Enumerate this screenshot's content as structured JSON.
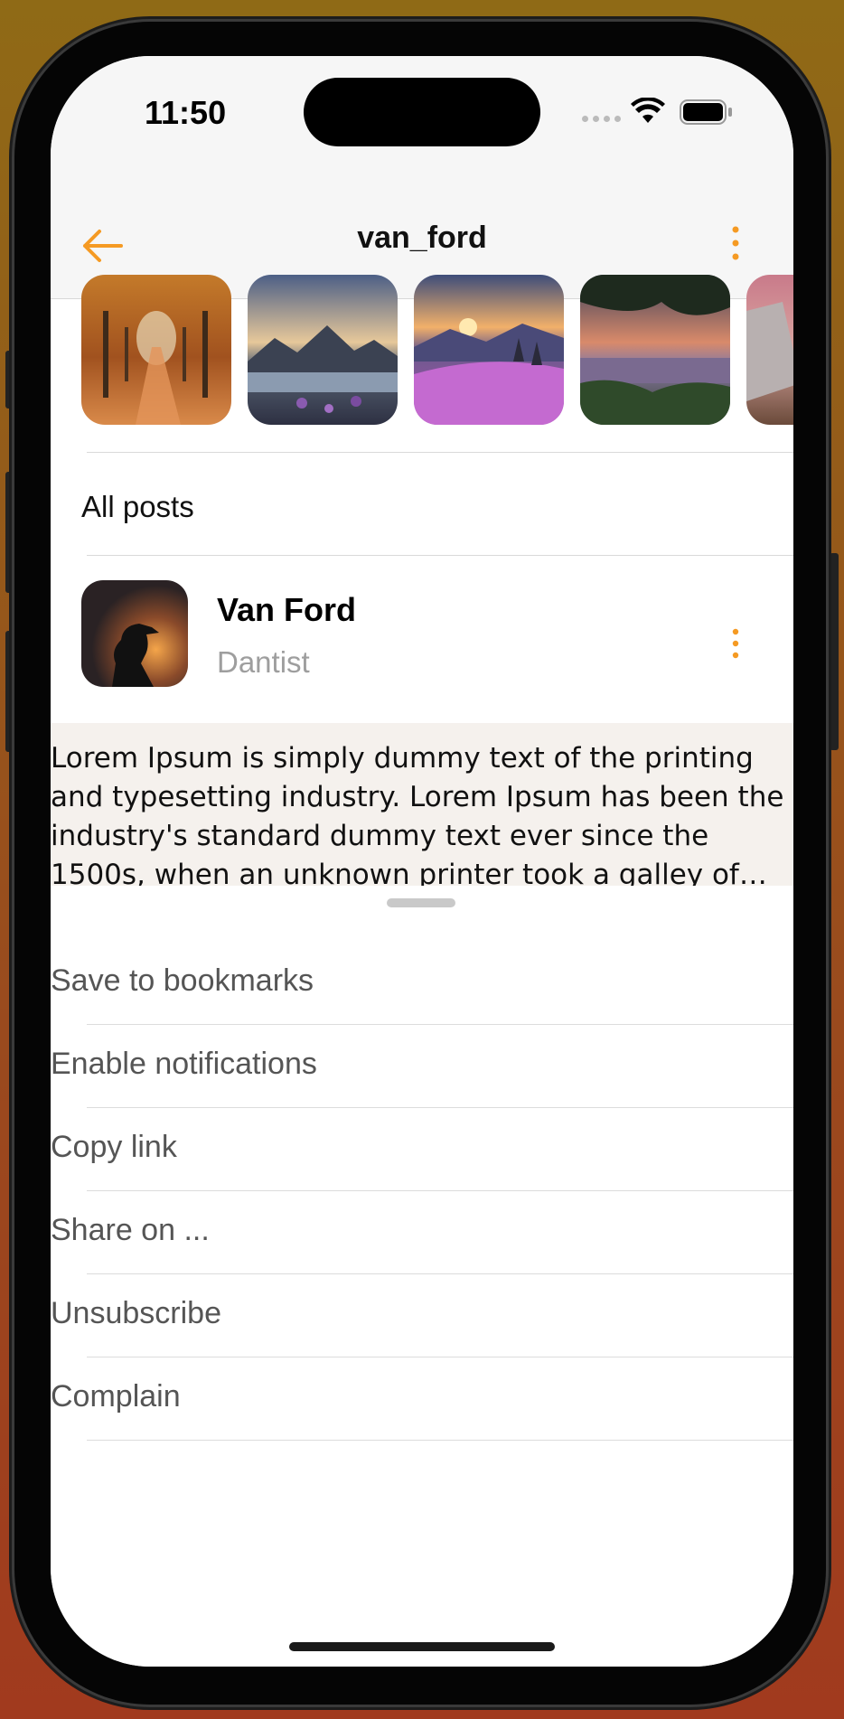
{
  "status_bar": {
    "time": "11:50"
  },
  "nav": {
    "title": "van_ford"
  },
  "stories": [
    {
      "name": "autumn-alley"
    },
    {
      "name": "mountain-lake-sunrise"
    },
    {
      "name": "flower-meadow-sunset"
    },
    {
      "name": "lake-tree-sunset"
    },
    {
      "name": "cliff-coast"
    }
  ],
  "section": {
    "label": "All posts"
  },
  "post": {
    "author": "Van Ford",
    "role": "Dantist",
    "text": "Lorem Ipsum is simply dummy text of the printing and typesetting industry. Lorem Ipsum has been the industry's standard dummy text ever since the 1500s, when an unknown printer took a galley of type and scrambled it to make a type specimen book."
  },
  "menu": {
    "items": [
      {
        "label": "Save to bookmarks"
      },
      {
        "label": "Enable notifications"
      },
      {
        "label": "Copy link"
      },
      {
        "label": "Share on ..."
      },
      {
        "label": "Unsubscribe"
      },
      {
        "label": "Complain"
      }
    ]
  },
  "colors": {
    "accent": "#F59A23",
    "sheet_bg": "#FFFFFF",
    "post_bg": "#F5F1ED"
  }
}
